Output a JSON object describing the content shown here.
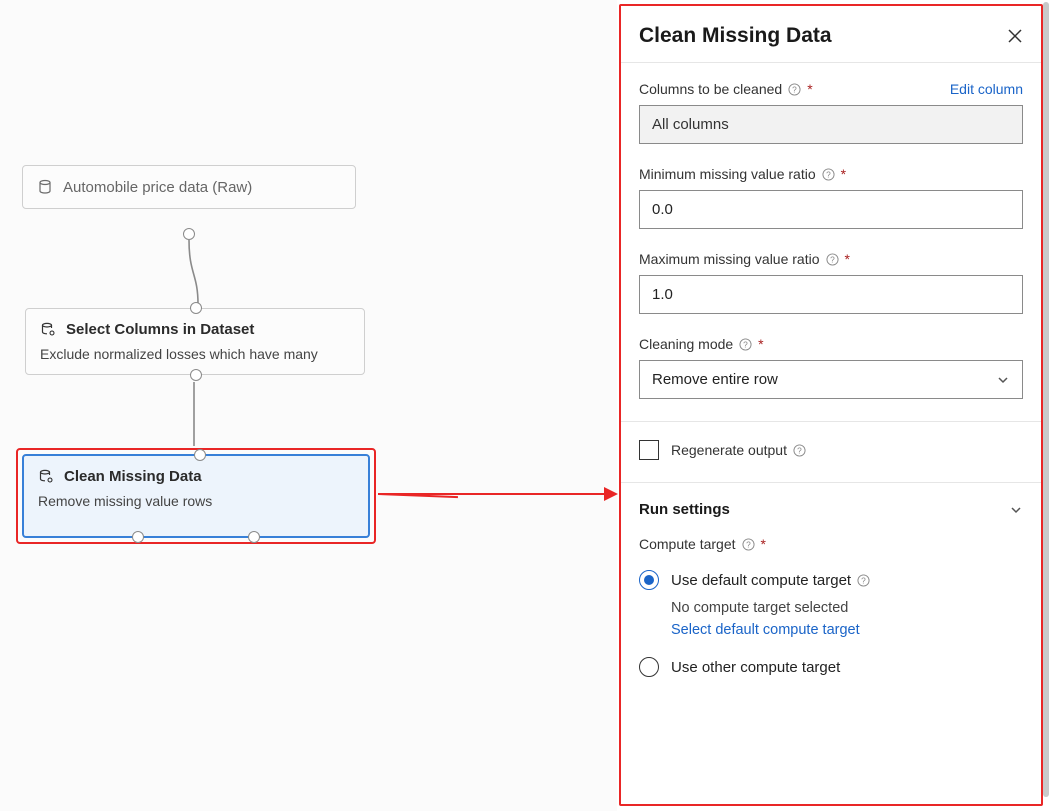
{
  "canvas": {
    "node1": {
      "title": "Automobile price data (Raw)"
    },
    "node2": {
      "title": "Select Columns in Dataset",
      "subtitle": "Exclude normalized losses which have many"
    },
    "node3": {
      "title": "Clean Missing Data",
      "subtitle": "Remove missing value rows"
    }
  },
  "panel": {
    "title": "Clean Missing Data",
    "columns_label": "Columns to be cleaned",
    "edit_column": "Edit column",
    "columns_value": "All columns",
    "min_ratio_label": "Minimum missing value ratio",
    "min_ratio_value": "0.0",
    "max_ratio_label": "Maximum missing value ratio",
    "max_ratio_value": "1.0",
    "cleaning_mode_label": "Cleaning mode",
    "cleaning_mode_value": "Remove entire row",
    "regenerate_label": "Regenerate output",
    "run_settings": "Run settings",
    "compute_target_label": "Compute target",
    "radio_default": "Use default compute target",
    "radio_default_sub": "No compute target selected",
    "select_default_link": "Select default compute target",
    "radio_other": "Use other compute target"
  }
}
